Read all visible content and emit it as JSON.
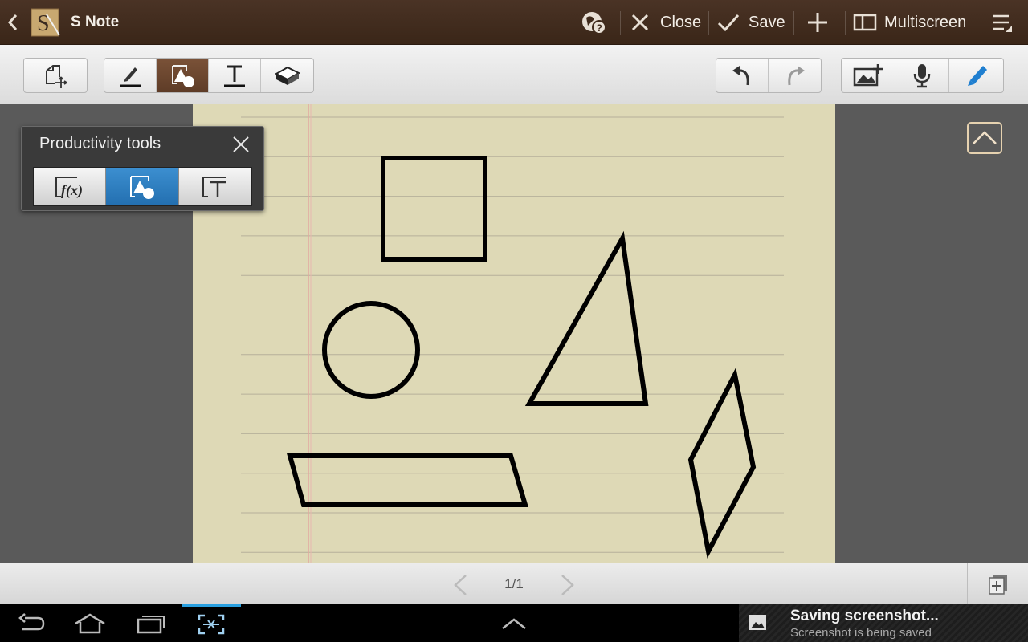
{
  "actionbar": {
    "app_title": "S Note",
    "close_label": "Close",
    "save_label": "Save",
    "multiscreen_label": "Multiscreen",
    "icons": [
      "back-chevron-icon",
      "snote-app-icon",
      "help-globe-icon",
      "close-x-icon",
      "checkmark-icon",
      "plus-icon",
      "multiscreen-icon",
      "menu-icon"
    ]
  },
  "toolbar": {
    "left_group": [
      "select-move-icon"
    ],
    "mode_group": [
      "pen-icon",
      "shape-icon",
      "text-icon",
      "eraser-icon"
    ],
    "active_mode": "shape",
    "history_group": [
      "undo-icon",
      "redo-icon"
    ],
    "insert_group": [
      "insert-image-icon",
      "voice-record-icon",
      "brush-pen-icon"
    ]
  },
  "productivity_panel": {
    "title": "Productivity tools",
    "tools": [
      "formula-match",
      "shape-match",
      "text-recognition"
    ],
    "active_tool": "shape-match"
  },
  "page": {
    "indicator": "1/1"
  },
  "notification": {
    "title": "Saving screenshot...",
    "subtitle": "Screenshot is being saved"
  },
  "colors": {
    "actionbar_bg": "#3f2a1c",
    "paper": "#ded9b6",
    "active_tool": "#2f7fc2",
    "active_mode": "#6a4630",
    "pen_blue": "#1f7fd0"
  }
}
